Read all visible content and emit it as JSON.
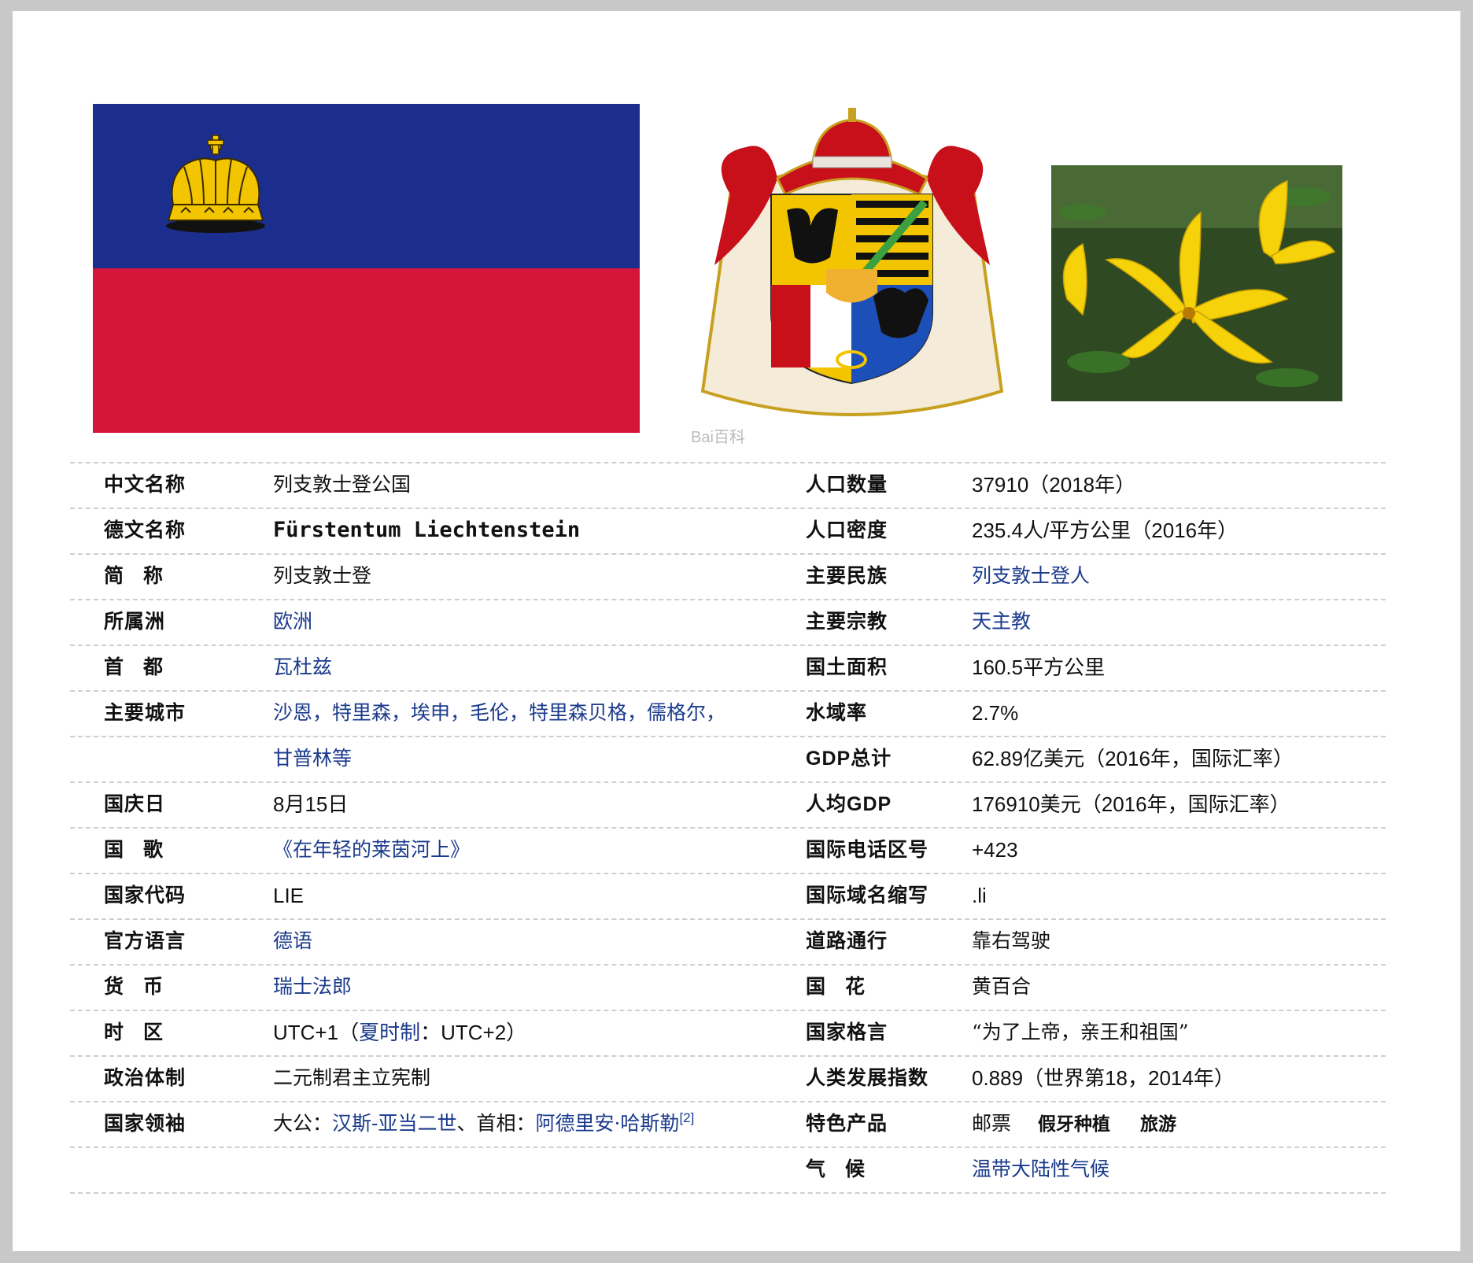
{
  "images": {
    "flag": {
      "name": "liechtenstein-flag",
      "top_color": "#1b2e8e",
      "bottom_color": "#d4163b",
      "crown_color": "#f2c500"
    },
    "coat_of_arms": {
      "name": "coat-of-arms",
      "watermark": "Bai百科"
    },
    "national_flower": {
      "name": "yellow-lily-photo"
    }
  },
  "left": [
    {
      "label": "中文名称",
      "value": "列支敦士登公国"
    },
    {
      "label": "德文名称",
      "value": "Fürstentum Liechtenstein"
    },
    {
      "label": "简　称",
      "value": "列支敦士登"
    },
    {
      "label": "所属洲",
      "value": "欧洲"
    },
    {
      "label": "首　都",
      "value": "瓦杜兹"
    },
    {
      "label": "主要城市",
      "value": "沙恩，特里森，埃申，毛伦，特里森贝格，儒格尔，"
    },
    {
      "label": "",
      "value": "甘普林等"
    },
    {
      "label": "国庆日",
      "value": "8月15日"
    },
    {
      "label": "国　歌",
      "value": "《在年轻的莱茵河上》"
    },
    {
      "label": "国家代码",
      "value": "LIE"
    },
    {
      "label": "官方语言",
      "value": "德语"
    },
    {
      "label": "货　币",
      "value": "瑞士法郎"
    },
    {
      "label": "时　区",
      "value_a": "UTC+1（",
      "value_b": "夏时制",
      "value_c": "：UTC+2）"
    },
    {
      "label": "政治体制",
      "value": "二元制君主立宪制"
    },
    {
      "label": "国家领袖",
      "value_a": "大公：",
      "value_b": "汉斯-亚当二世",
      "value_c": "、首相：",
      "value_d": "阿德里安·哈斯勒",
      "ref": "[2]"
    }
  ],
  "right": [
    {
      "label": "人口数量",
      "value": "37910（2018年）"
    },
    {
      "label": "人口密度",
      "value": "235.4人/平方公里（2016年）"
    },
    {
      "label": "主要民族",
      "value": "列支敦士登人"
    },
    {
      "label": "主要宗教",
      "value": "天主教"
    },
    {
      "label": "国土面积",
      "value": "160.5平方公里"
    },
    {
      "label": "水域率",
      "value": "2.7%"
    },
    {
      "label": "GDP总计",
      "value": "62.89亿美元（2016年，国际汇率）"
    },
    {
      "label": "人均GDP",
      "value": "176910美元（2016年，国际汇率）"
    },
    {
      "label": "国际电话区号",
      "value": "+423"
    },
    {
      "label": "国际域名缩写",
      "value": ".li"
    },
    {
      "label": "道路通行",
      "value": "靠右驾驶"
    },
    {
      "label": "国　花",
      "value": "黄百合"
    },
    {
      "label": "国家格言",
      "value": "“为了上帝，亲王和祖国”"
    },
    {
      "label": "人类发展指数",
      "value": "0.889（世界第18，2014年）"
    },
    {
      "label": "特色产品",
      "value_a": "邮票",
      "value_b": "假牙种植",
      "value_c": "旅游"
    },
    {
      "label": "气　候",
      "value": "温带大陆性气候"
    }
  ]
}
